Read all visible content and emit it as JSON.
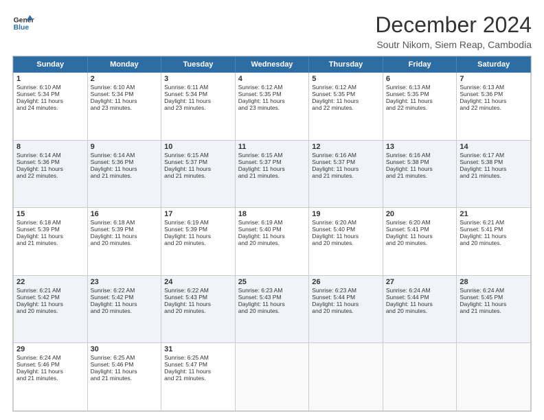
{
  "header": {
    "logo_line1": "General",
    "logo_line2": "Blue",
    "title": "December 2024",
    "subtitle": "Soutr Nikom, Siem Reap, Cambodia"
  },
  "days_of_week": [
    "Sunday",
    "Monday",
    "Tuesday",
    "Wednesday",
    "Thursday",
    "Friday",
    "Saturday"
  ],
  "weeks": [
    [
      {
        "day": "1",
        "lines": [
          "Sunrise: 6:10 AM",
          "Sunset: 5:34 PM",
          "Daylight: 11 hours",
          "and 24 minutes."
        ]
      },
      {
        "day": "2",
        "lines": [
          "Sunrise: 6:10 AM",
          "Sunset: 5:34 PM",
          "Daylight: 11 hours",
          "and 23 minutes."
        ]
      },
      {
        "day": "3",
        "lines": [
          "Sunrise: 6:11 AM",
          "Sunset: 5:34 PM",
          "Daylight: 11 hours",
          "and 23 minutes."
        ]
      },
      {
        "day": "4",
        "lines": [
          "Sunrise: 6:12 AM",
          "Sunset: 5:35 PM",
          "Daylight: 11 hours",
          "and 23 minutes."
        ]
      },
      {
        "day": "5",
        "lines": [
          "Sunrise: 6:12 AM",
          "Sunset: 5:35 PM",
          "Daylight: 11 hours",
          "and 22 minutes."
        ]
      },
      {
        "day": "6",
        "lines": [
          "Sunrise: 6:13 AM",
          "Sunset: 5:35 PM",
          "Daylight: 11 hours",
          "and 22 minutes."
        ]
      },
      {
        "day": "7",
        "lines": [
          "Sunrise: 6:13 AM",
          "Sunset: 5:36 PM",
          "Daylight: 11 hours",
          "and 22 minutes."
        ]
      }
    ],
    [
      {
        "day": "8",
        "lines": [
          "Sunrise: 6:14 AM",
          "Sunset: 5:36 PM",
          "Daylight: 11 hours",
          "and 22 minutes."
        ]
      },
      {
        "day": "9",
        "lines": [
          "Sunrise: 6:14 AM",
          "Sunset: 5:36 PM",
          "Daylight: 11 hours",
          "and 21 minutes."
        ]
      },
      {
        "day": "10",
        "lines": [
          "Sunrise: 6:15 AM",
          "Sunset: 5:37 PM",
          "Daylight: 11 hours",
          "and 21 minutes."
        ]
      },
      {
        "day": "11",
        "lines": [
          "Sunrise: 6:15 AM",
          "Sunset: 5:37 PM",
          "Daylight: 11 hours",
          "and 21 minutes."
        ]
      },
      {
        "day": "12",
        "lines": [
          "Sunrise: 6:16 AM",
          "Sunset: 5:37 PM",
          "Daylight: 11 hours",
          "and 21 minutes."
        ]
      },
      {
        "day": "13",
        "lines": [
          "Sunrise: 6:16 AM",
          "Sunset: 5:38 PM",
          "Daylight: 11 hours",
          "and 21 minutes."
        ]
      },
      {
        "day": "14",
        "lines": [
          "Sunrise: 6:17 AM",
          "Sunset: 5:38 PM",
          "Daylight: 11 hours",
          "and 21 minutes."
        ]
      }
    ],
    [
      {
        "day": "15",
        "lines": [
          "Sunrise: 6:18 AM",
          "Sunset: 5:39 PM",
          "Daylight: 11 hours",
          "and 21 minutes."
        ]
      },
      {
        "day": "16",
        "lines": [
          "Sunrise: 6:18 AM",
          "Sunset: 5:39 PM",
          "Daylight: 11 hours",
          "and 20 minutes."
        ]
      },
      {
        "day": "17",
        "lines": [
          "Sunrise: 6:19 AM",
          "Sunset: 5:39 PM",
          "Daylight: 11 hours",
          "and 20 minutes."
        ]
      },
      {
        "day": "18",
        "lines": [
          "Sunrise: 6:19 AM",
          "Sunset: 5:40 PM",
          "Daylight: 11 hours",
          "and 20 minutes."
        ]
      },
      {
        "day": "19",
        "lines": [
          "Sunrise: 6:20 AM",
          "Sunset: 5:40 PM",
          "Daylight: 11 hours",
          "and 20 minutes."
        ]
      },
      {
        "day": "20",
        "lines": [
          "Sunrise: 6:20 AM",
          "Sunset: 5:41 PM",
          "Daylight: 11 hours",
          "and 20 minutes."
        ]
      },
      {
        "day": "21",
        "lines": [
          "Sunrise: 6:21 AM",
          "Sunset: 5:41 PM",
          "Daylight: 11 hours",
          "and 20 minutes."
        ]
      }
    ],
    [
      {
        "day": "22",
        "lines": [
          "Sunrise: 6:21 AM",
          "Sunset: 5:42 PM",
          "Daylight: 11 hours",
          "and 20 minutes."
        ]
      },
      {
        "day": "23",
        "lines": [
          "Sunrise: 6:22 AM",
          "Sunset: 5:42 PM",
          "Daylight: 11 hours",
          "and 20 minutes."
        ]
      },
      {
        "day": "24",
        "lines": [
          "Sunrise: 6:22 AM",
          "Sunset: 5:43 PM",
          "Daylight: 11 hours",
          "and 20 minutes."
        ]
      },
      {
        "day": "25",
        "lines": [
          "Sunrise: 6:23 AM",
          "Sunset: 5:43 PM",
          "Daylight: 11 hours",
          "and 20 minutes."
        ]
      },
      {
        "day": "26",
        "lines": [
          "Sunrise: 6:23 AM",
          "Sunset: 5:44 PM",
          "Daylight: 11 hours",
          "and 20 minutes."
        ]
      },
      {
        "day": "27",
        "lines": [
          "Sunrise: 6:24 AM",
          "Sunset: 5:44 PM",
          "Daylight: 11 hours",
          "and 20 minutes."
        ]
      },
      {
        "day": "28",
        "lines": [
          "Sunrise: 6:24 AM",
          "Sunset: 5:45 PM",
          "Daylight: 11 hours",
          "and 21 minutes."
        ]
      }
    ],
    [
      {
        "day": "29",
        "lines": [
          "Sunrise: 6:24 AM",
          "Sunset: 5:46 PM",
          "Daylight: 11 hours",
          "and 21 minutes."
        ]
      },
      {
        "day": "30",
        "lines": [
          "Sunrise: 6:25 AM",
          "Sunset: 5:46 PM",
          "Daylight: 11 hours",
          "and 21 minutes."
        ]
      },
      {
        "day": "31",
        "lines": [
          "Sunrise: 6:25 AM",
          "Sunset: 5:47 PM",
          "Daylight: 11 hours",
          "and 21 minutes."
        ]
      },
      {
        "day": "",
        "lines": []
      },
      {
        "day": "",
        "lines": []
      },
      {
        "day": "",
        "lines": []
      },
      {
        "day": "",
        "lines": []
      }
    ]
  ]
}
